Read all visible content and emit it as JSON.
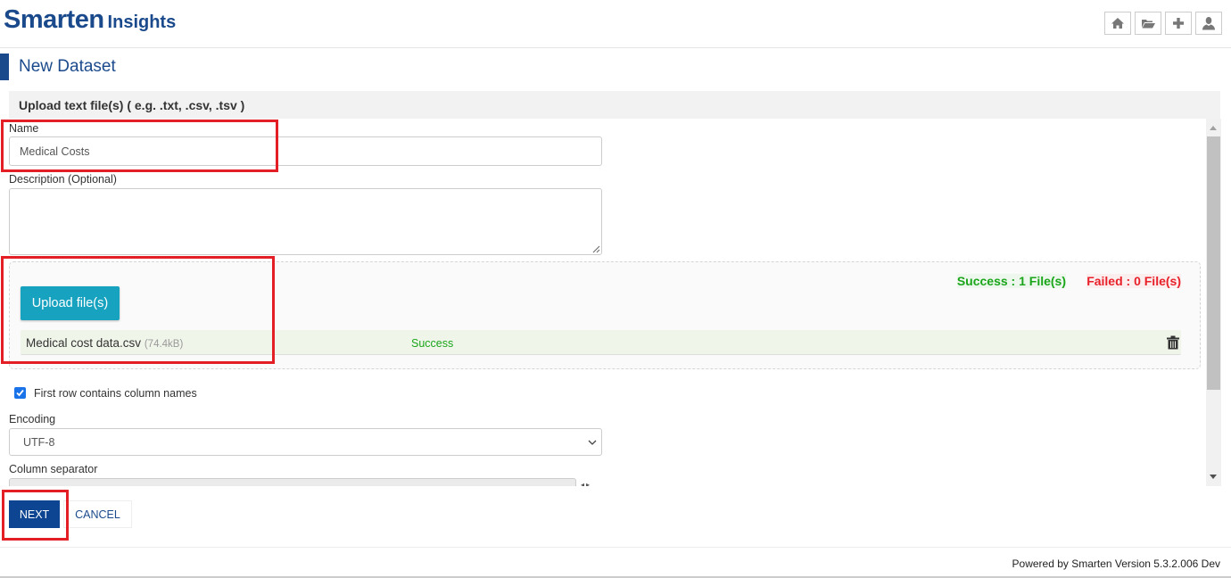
{
  "header": {
    "brand_main": "Smarten",
    "brand_sub": "Insights",
    "icons": [
      "home-icon",
      "folder-open-icon",
      "plus-icon",
      "user-icon"
    ]
  },
  "page": {
    "title": "New Dataset",
    "panel_title": "Upload text file(s) ( e.g. .txt, .csv, .tsv )"
  },
  "form": {
    "name_label": "Name",
    "name_value": "Medical Costs",
    "description_label": "Description (Optional)",
    "description_value": "",
    "upload_button": "Upload file(s)",
    "success_count": "Success : 1 File(s)",
    "failed_count": "Failed : 0 File(s)",
    "files": [
      {
        "name": "Medical cost data.csv",
        "size": "74.4kB",
        "status": "Success"
      }
    ],
    "first_row_label": "First row contains column names",
    "first_row_checked": true,
    "encoding_label": "Encoding",
    "encoding_value": "UTF-8",
    "separator_label": "Column separator",
    "separator_value": ""
  },
  "actions": {
    "next": "NEXT",
    "cancel": "CANCEL"
  },
  "footer": {
    "text": "Powered by Smarten Version 5.3.2.006 Dev"
  },
  "colors": {
    "brand": "#1b4a8c",
    "upload_button": "#17a2c0",
    "success": "#1aa51a",
    "failed": "#e8202a",
    "next_button": "#0d4592",
    "highlight": "#e31e24"
  }
}
